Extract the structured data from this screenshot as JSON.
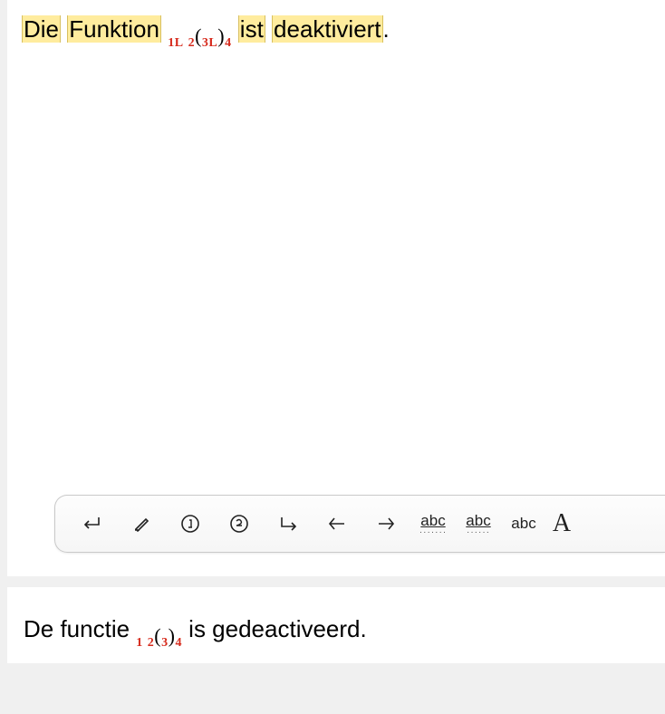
{
  "top": {
    "w1": "Die",
    "w2": "Funktion",
    "formula": {
      "s1": "1L",
      "s2": "2",
      "inner": "3L",
      "s4": "4"
    },
    "w3": "ist",
    "w4": "deaktiviert",
    "period": "."
  },
  "bottom": {
    "pre": "De functie ",
    "formula": {
      "s1": "1",
      "s2": "2",
      "inner": "3",
      "s4": "4"
    },
    "post": " is gedeactiveerd."
  },
  "toolbar": {
    "abc1": "abc",
    "abc2": "abc",
    "abc3": "abc",
    "bigA": "A"
  }
}
